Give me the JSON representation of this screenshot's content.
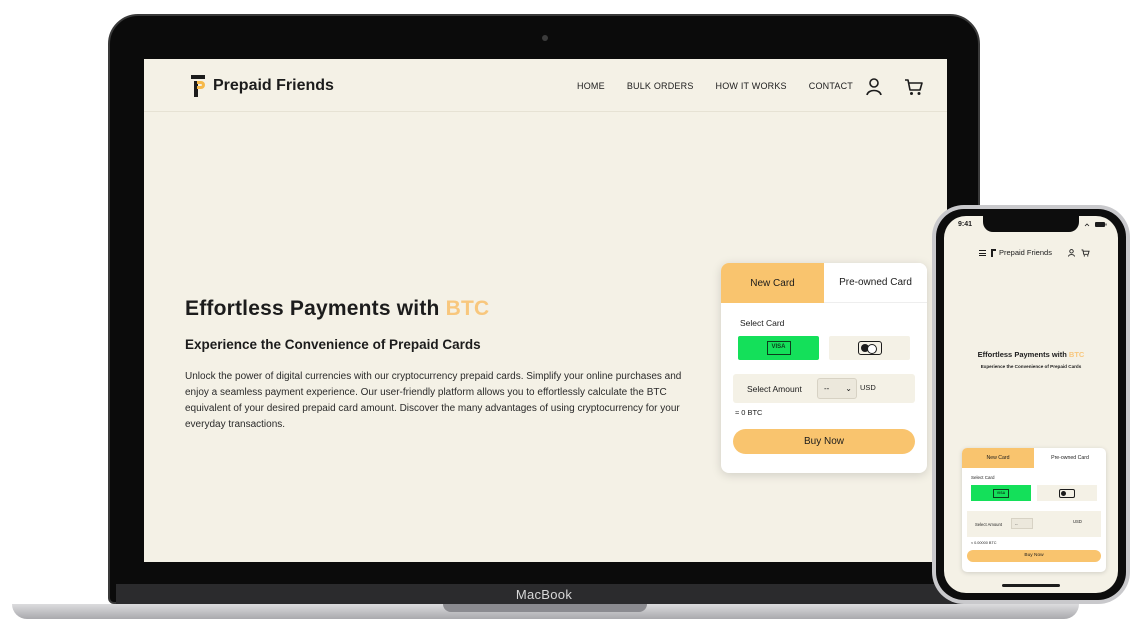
{
  "desktop": {
    "nav": {
      "logo_text": "Prepaid Friends",
      "menu": [
        "HOME",
        "BULK ORDERS",
        "HOW IT WORKS",
        "CONTACT"
      ]
    },
    "hero": {
      "title_main": "Effortless Payments with ",
      "title_accent": "BTC",
      "subtitle": "Experience the Convenience of Prepaid Cards",
      "description": "Unlock the power of digital currencies with our cryptocurrency prepaid cards. Simplify your online purchases and enjoy a seamless payment experience. Our user-friendly platform allows you to effortlessly calculate the BTC equivalent of your desired prepaid card amount. Discover the many advantages of using cryptocurrency for your everyday transactions."
    },
    "widget": {
      "tab_new": "New Card",
      "tab_preowned": "Pre-owned Card",
      "select_card_label": "Select Card",
      "visa_label": "VISA",
      "amount_label": "Select Amount",
      "amount_value": "--",
      "amount_unit": "USD",
      "btc_estimate": "≈ 0 BTC",
      "buy_label": "Buy Now"
    }
  },
  "laptop_brand": "MacBook",
  "phone": {
    "status_time": "9:41",
    "logo_text": "Prepaid Friends",
    "title_main": "Effortless Payments with ",
    "title_accent": "BTC",
    "subtitle": "Experience the Convenience of Prepaid Cards",
    "widget": {
      "tab_new": "New Card",
      "tab_preowned": "Pre-owned Card",
      "select_card_label": "Select Card",
      "visa_label": "VISA",
      "amount_label": "Select Amount",
      "amount_value": "--",
      "amount_unit": "USD",
      "btc_estimate": "≈ 0.00000 BTC",
      "buy_label": "Buy Now"
    }
  },
  "colors": {
    "background": "#f4f1e6",
    "accent": "#f9c46e",
    "visa_green": "#14e05a"
  }
}
